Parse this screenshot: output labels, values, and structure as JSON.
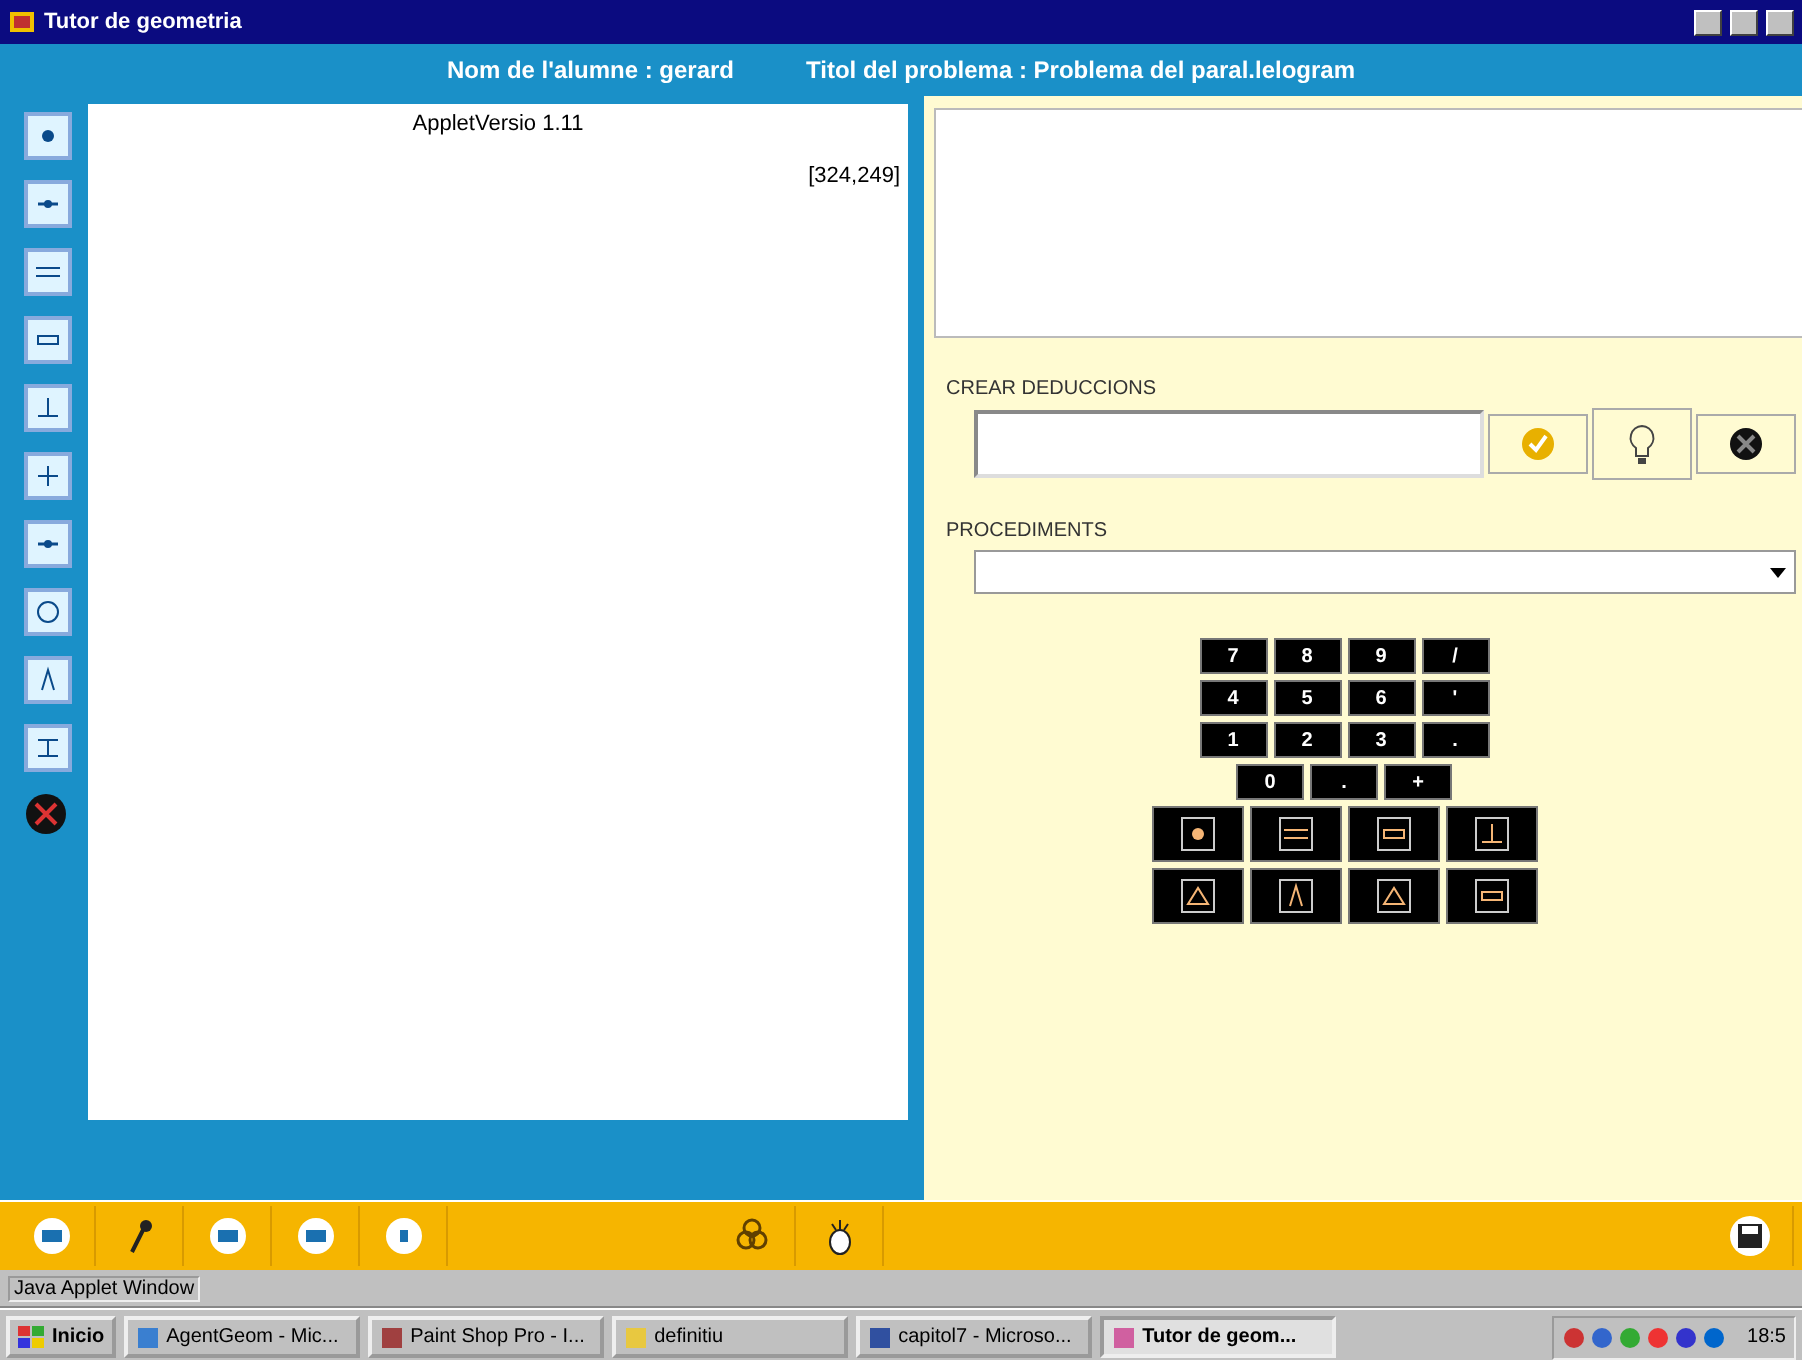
{
  "window": {
    "title": "Tutor de geometria"
  },
  "header": {
    "student": "Nom de l'alumne : gerard",
    "problem": "Titol del problema : Problema del paral.lelogram"
  },
  "canvas": {
    "version": "AppletVersio 1.11",
    "coordinates": "[324,249]"
  },
  "deductions": {
    "label": "CREAR DEDUCCIONS"
  },
  "procedures": {
    "label": "PROCEDIMENTS"
  },
  "keypad": {
    "rows": [
      [
        "7",
        "8",
        "9",
        "/"
      ],
      [
        "4",
        "5",
        "6",
        "'"
      ],
      [
        "1",
        "2",
        "3",
        "."
      ],
      [
        "0",
        ".",
        "+"
      ]
    ]
  },
  "status_bar": {
    "text": "Java Applet Window"
  },
  "taskbar": {
    "start": "Inicio",
    "items": [
      {
        "label": "AgentGeom - Mic...",
        "selected": false
      },
      {
        "label": "Paint Shop Pro - I...",
        "selected": false
      },
      {
        "label": "definitiu",
        "selected": false
      },
      {
        "label": "capitol7 - Microso...",
        "selected": false
      },
      {
        "label": "Tutor de geom...",
        "selected": true
      }
    ],
    "clock": "18:5"
  }
}
